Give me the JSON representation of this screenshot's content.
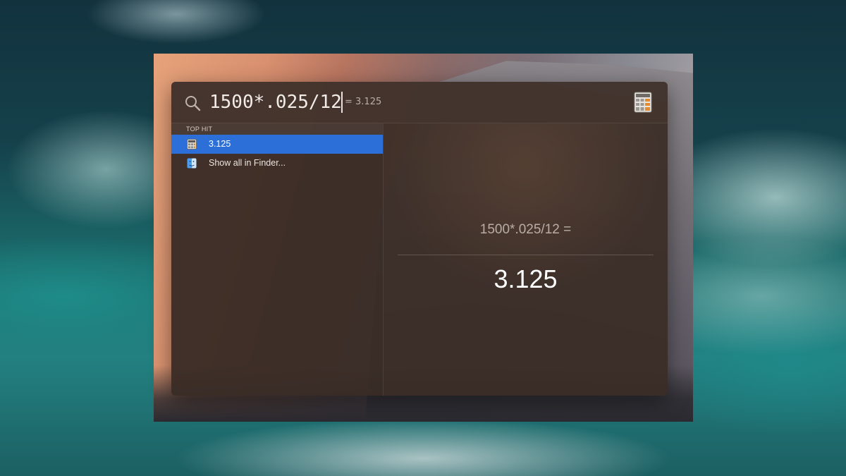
{
  "search": {
    "query": "1500*.025/12",
    "inline_result": "= 3.125"
  },
  "results": {
    "section_label": "TOP HIT",
    "items": [
      {
        "label": "3.125",
        "icon": "calculator-icon",
        "selected": true
      },
      {
        "label": "Show all in Finder...",
        "icon": "finder-icon",
        "selected": false
      }
    ]
  },
  "preview": {
    "expression": "1500*.025/12 =",
    "answer": "3.125"
  },
  "colors": {
    "selection": "#2d6fd8",
    "panel": "#3a2c26"
  }
}
